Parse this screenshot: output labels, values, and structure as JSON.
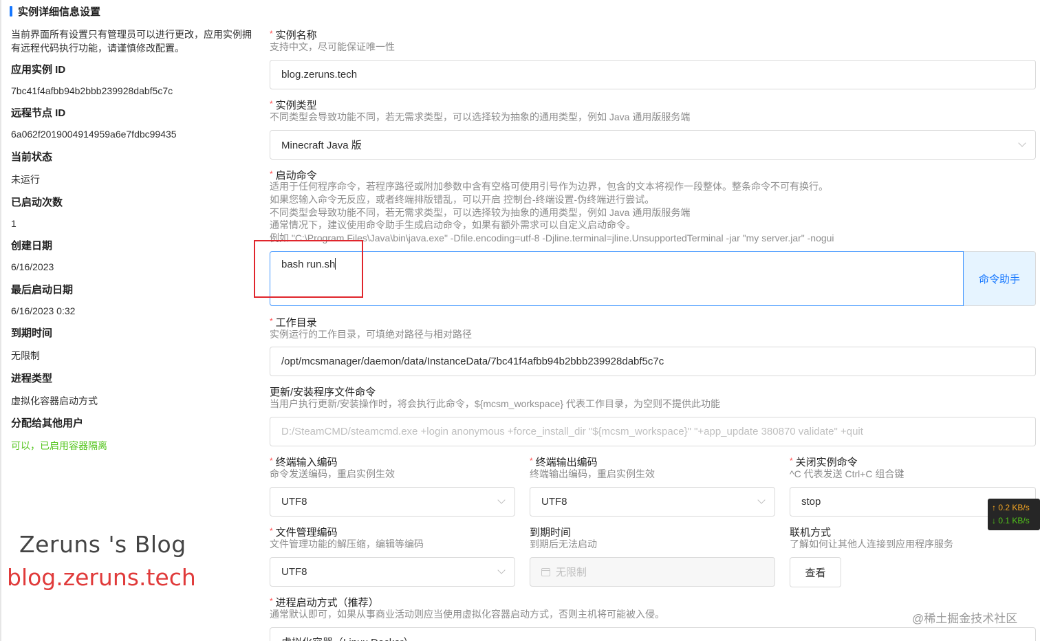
{
  "section_title": "实例详细信息设置",
  "intro": "当前界面所有设置只有管理员可以进行更改，应用实例拥有远程代码执行功能，请谨慎修改配置。",
  "info": [
    {
      "label": "应用实例 ID",
      "value": "7bc41f4afbb94b2bbb239928dabf5c7c"
    },
    {
      "label": "远程节点 ID",
      "value": "6a062f2019004914959a6e7fdbc99435"
    },
    {
      "label": "当前状态",
      "value": "未运行"
    },
    {
      "label": "已启动次数",
      "value": "1"
    },
    {
      "label": "创建日期",
      "value": "6/16/2023"
    },
    {
      "label": "最后启动日期",
      "value": "6/16/2023 0:32"
    },
    {
      "label": "到期时间",
      "value": "无限制"
    },
    {
      "label": "进程类型",
      "value": "虚拟化容器启动方式"
    },
    {
      "label": "分配给其他用户",
      "value": "可以，已启用容器隔离",
      "accent": "#52c41a"
    }
  ],
  "watermark": {
    "name": "Zeruns 's Blog",
    "url": "blog.zeruns.tech",
    "url_color": "#e03a3a"
  },
  "form": {
    "instance_name": {
      "label": "实例名称",
      "hint": "支持中文，尽可能保证唯一性",
      "value": "blog.zeruns.tech"
    },
    "instance_type": {
      "label": "实例类型",
      "hint": "不同类型会导致功能不同，若无需求类型，可以选择较为抽象的通用类型，例如 Java 通用版服务端",
      "value": "Minecraft Java 版"
    },
    "start_command": {
      "label": "启动命令",
      "hints": [
        "适用于任何程序命令，若程序路径或附加参数中含有空格可使用引号作为边界，包含的文本将视作一段整体。整条命令不可有换行。",
        "如果您输入命令无反应，或者终端排版错乱，可以开启 控制台-终端设置-伪终端进行尝试。",
        "不同类型会导致功能不同，若无需求类型，可以选择较为抽象的通用类型，例如 Java 通用版服务端",
        "通常情况下，建议使用命令助手生成启动命令，如果有额外需求可以自定义启动命令。",
        "例如 \"C:\\Program Files\\Java\\bin\\java.exe\" -Dfile.encoding=utf-8 -Djline.terminal=jline.UnsupportedTerminal -jar \"my server.jar\" -nogui"
      ],
      "value": "bash run.sh",
      "helper_label": "命令助手"
    },
    "work_dir": {
      "label": "工作目录",
      "hint": "实例运行的工作目录，可填绝对路径与相对路径",
      "value": "/opt/mcsmanager/daemon/data/InstanceData/7bc41f4afbb94b2bbb239928dabf5c7c"
    },
    "update_command": {
      "label": "更新/安装程序文件命令",
      "hint": "当用户执行更新/安装操作时，将会执行此命令，${mcsm_workspace} 代表工作目录，为空则不提供此功能",
      "placeholder": "D:/SteamCMD/steamcmd.exe +login anonymous +force_install_dir \"${mcsm_workspace}\" \"+app_update 380870 validate\" +quit"
    },
    "input_encoding": {
      "label": "终端输入编码",
      "hint": "命令发送编码，重启实例生效",
      "value": "UTF8"
    },
    "output_encoding": {
      "label": "终端输出编码",
      "hint": "终端输出编码，重启实例生效",
      "value": "UTF8"
    },
    "stop_command": {
      "label": "关闭实例命令",
      "hint": "^C 代表发送 Ctrl+C 组合键",
      "value": "stop"
    },
    "file_encoding": {
      "label": "文件管理编码",
      "hint": "文件管理功能的解压缩，编辑等编码",
      "value": "UTF8"
    },
    "expire_time": {
      "label": "到期时间",
      "hint": "到期后无法启动",
      "placeholder": "无限制"
    },
    "connect": {
      "label": "联机方式",
      "hint": "了解如何让其他人连接到应用程序服务",
      "button": "查看"
    },
    "process_mode": {
      "label": "进程启动方式（推荐）",
      "hint": "通常默认即可，如果从事商业活动则应当使用虚拟化容器启动方式，否则主机将可能被入侵。",
      "value": "虚拟化容器（Linux Docker）"
    }
  },
  "netspeed": {
    "up": "↑ 0.2 KB/s",
    "down": "↓ 0.1 KB/s"
  },
  "footer_watermark": "@稀土掘金技术社区"
}
